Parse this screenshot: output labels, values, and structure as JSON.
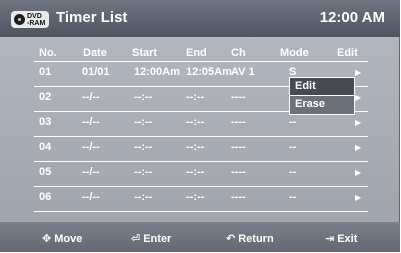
{
  "title_bar": {
    "badge_top": "DVD",
    "badge_bottom": "-RAM",
    "title": "Timer List",
    "clock": "12:00 AM"
  },
  "table": {
    "headers": [
      "No.",
      "Date",
      "Start",
      "End",
      "Ch",
      "Mode",
      "Edit"
    ],
    "rows": [
      {
        "no": "01",
        "date": "01/01",
        "start": "12:00Am",
        "end": "12:05Am",
        "ch": "AV 1",
        "mode": "S"
      },
      {
        "no": "02",
        "date": "--/--",
        "start": "--:--",
        "end": "--:--",
        "ch": "----",
        "mode": "--"
      },
      {
        "no": "03",
        "date": "--/--",
        "start": "--:--",
        "end": "--:--",
        "ch": "----",
        "mode": "--"
      },
      {
        "no": "04",
        "date": "--/--",
        "start": "--:--",
        "end": "--:--",
        "ch": "----",
        "mode": "--"
      },
      {
        "no": "05",
        "date": "--/--",
        "start": "--:--",
        "end": "--:--",
        "ch": "----",
        "mode": "--"
      },
      {
        "no": "06",
        "date": "--/--",
        "start": "--:--",
        "end": "--:--",
        "ch": "----",
        "mode": "--"
      }
    ],
    "arrow_icon": "▶"
  },
  "popup": {
    "items": [
      "Edit",
      "Erase"
    ],
    "selected": "Edit"
  },
  "footer": {
    "move": {
      "icon": "move-icon",
      "glyph": "✥",
      "label": "Move"
    },
    "enter": {
      "icon": "enter-icon",
      "glyph": "⏎",
      "label": "Enter"
    },
    "return": {
      "icon": "return-icon",
      "glyph": "↶",
      "label": "Return"
    },
    "exit": {
      "icon": "exit-icon",
      "glyph": "⇥",
      "label": "Exit"
    }
  },
  "colors": {
    "title_bar": "#5a606b",
    "background": "#a7acb5",
    "text": "#ffffff",
    "popup_selected": "#454a53"
  }
}
